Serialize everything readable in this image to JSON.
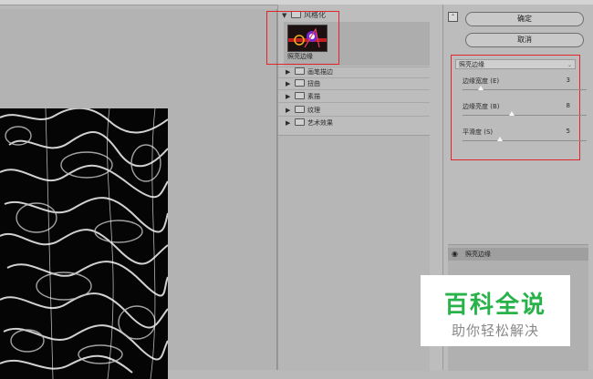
{
  "browser": {
    "expanded_group": "风格化",
    "selected_filter": "照亮边缘",
    "groups": [
      "画笔描边",
      "扭曲",
      "素描",
      "纹理",
      "艺术效果"
    ]
  },
  "actions": {
    "ok": "确定",
    "cancel": "取消"
  },
  "settings": {
    "filter_select": "照亮边缘",
    "params": [
      {
        "label": "边缘宽度 (E)",
        "value": "3",
        "fraction": 0.15
      },
      {
        "label": "边缘亮度 (B)",
        "value": "8",
        "fraction": 0.4
      },
      {
        "label": "平滑度 (S)",
        "value": "5",
        "fraction": 0.3
      }
    ]
  },
  "layers": {
    "active_layer": "照亮边缘"
  },
  "watermark": {
    "title": "百科全说",
    "subtitle": "助你轻松解决"
  },
  "colors": {
    "highlight_box": "#e0262a",
    "watermark_green": "#28b24a"
  }
}
